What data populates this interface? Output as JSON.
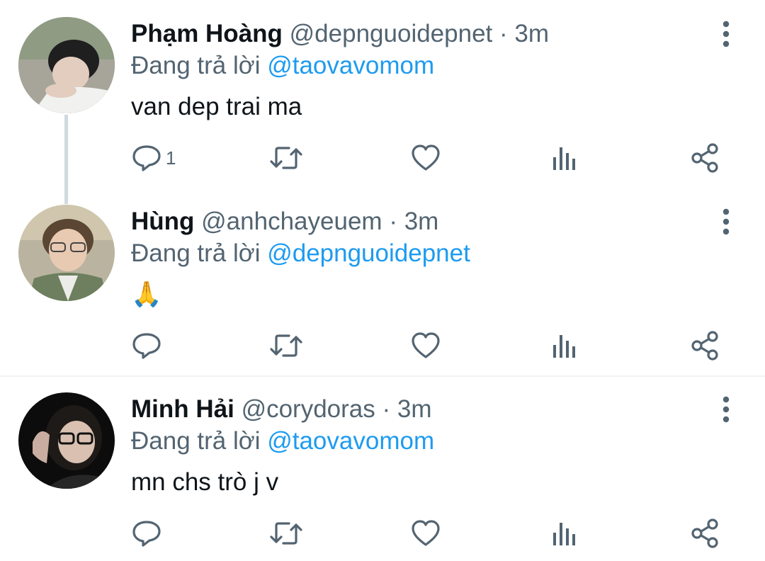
{
  "tweets": [
    {
      "name": "Phạm Hoàng",
      "handle": "@depnguoidepnet",
      "separator": "·",
      "time": "3m",
      "replying_label": "Đang trả lời",
      "replying_to": "@taovavomom",
      "text": "van dep trai ma",
      "reply_count": "1",
      "avatar_colors": [
        "#6f7f62",
        "#d9c9bb",
        "#1d1d1d"
      ]
    },
    {
      "name": "Hùng",
      "handle": "@anhchayeuem",
      "separator": "·",
      "time": "3m",
      "replying_label": "Đang trả lời",
      "replying_to": "@depnguoidepnet",
      "text": "🙏",
      "reply_count": "",
      "avatar_colors": [
        "#b7b29d",
        "#e6c8b0",
        "#6b7f5c"
      ]
    },
    {
      "name": "Minh Hải",
      "handle": "@corydoras",
      "separator": "·",
      "time": "3m",
      "replying_label": "Đang trả lời",
      "replying_to": "@taovavomom",
      "text": "mn chs trò j v",
      "reply_count": "",
      "avatar_colors": [
        "#0e0e0e",
        "#d8bfb0",
        "#2a2a2a"
      ]
    }
  ],
  "icons": {
    "reply": "reply-icon",
    "retweet": "retweet-icon",
    "like": "heart-icon",
    "analytics": "analytics-icon",
    "share": "share-icon",
    "more": "more-vertical-icon"
  },
  "colors": {
    "text_primary": "#0f1419",
    "text_secondary": "#536471",
    "link": "#1d9bf0",
    "thread_line": "#cfd9de",
    "divider": "#eff3f4"
  }
}
